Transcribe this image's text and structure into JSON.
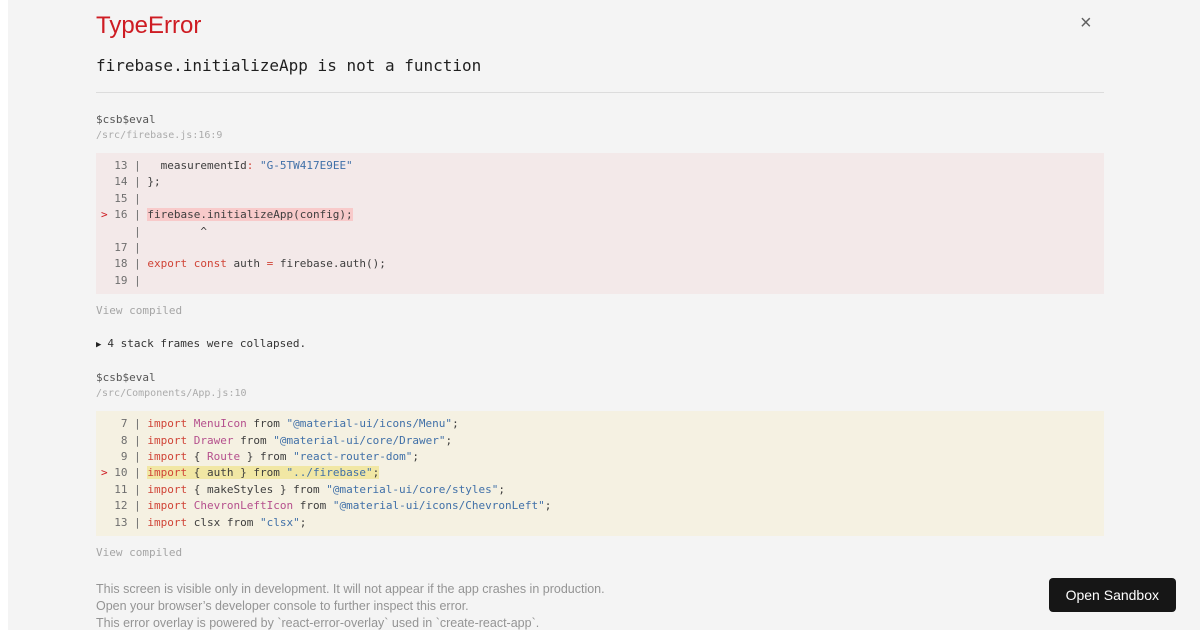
{
  "overlay": {
    "title": "TypeError",
    "message": "firebase.initializeApp is not a function",
    "close_glyph": "×"
  },
  "frames": [
    {
      "function": "$csb$eval",
      "location": "/src/firebase.js:16:9",
      "view_compiled": "View compiled",
      "variant": "error",
      "lines": [
        {
          "mark": " ",
          "num": "13",
          "tokens": [
            [
              "p",
              "  measurementId"
            ],
            [
              "k",
              ":"
            ],
            [
              "p",
              " "
            ],
            [
              "s",
              "\"G-5TW417E9EE\""
            ]
          ]
        },
        {
          "mark": " ",
          "num": "14",
          "tokens": [
            [
              "p",
              "};"
            ]
          ]
        },
        {
          "mark": " ",
          "num": "15",
          "tokens": []
        },
        {
          "mark": ">",
          "num": "16",
          "hl": true,
          "tokens": [
            [
              "p",
              "firebase.initializeApp(config);"
            ]
          ]
        },
        {
          "mark": " ",
          "num": "  ",
          "tokens": [
            [
              "p",
              "        ^"
            ]
          ]
        },
        {
          "mark": " ",
          "num": "17",
          "tokens": []
        },
        {
          "mark": " ",
          "num": "18",
          "tokens": [
            [
              "k",
              "export"
            ],
            [
              "p",
              " "
            ],
            [
              "k",
              "const"
            ],
            [
              "p",
              " auth "
            ],
            [
              "k",
              "="
            ],
            [
              "p",
              " firebase.auth();"
            ]
          ]
        },
        {
          "mark": " ",
          "num": "19",
          "tokens": []
        }
      ]
    },
    {
      "function": "$csb$eval",
      "location": "/src/Components/App.js:10",
      "view_compiled": "View compiled",
      "variant": "warning",
      "lines": [
        {
          "mark": " ",
          "num": " 7",
          "tokens": [
            [
              "k",
              "import"
            ],
            [
              "p",
              " "
            ],
            [
              "c",
              "MenuIcon"
            ],
            [
              "p",
              " from "
            ],
            [
              "s",
              "\"@material-ui/icons/Menu\""
            ],
            [
              "p",
              ";"
            ]
          ]
        },
        {
          "mark": " ",
          "num": " 8",
          "tokens": [
            [
              "k",
              "import"
            ],
            [
              "p",
              " "
            ],
            [
              "c",
              "Drawer"
            ],
            [
              "p",
              " from "
            ],
            [
              "s",
              "\"@material-ui/core/Drawer\""
            ],
            [
              "p",
              ";"
            ]
          ]
        },
        {
          "mark": " ",
          "num": " 9",
          "tokens": [
            [
              "k",
              "import"
            ],
            [
              "p",
              " { "
            ],
            [
              "c",
              "Route"
            ],
            [
              "p",
              " } from "
            ],
            [
              "s",
              "\"react-router-dom\""
            ],
            [
              "p",
              ";"
            ]
          ]
        },
        {
          "mark": ">",
          "num": "10",
          "hl": true,
          "tokens": [
            [
              "k",
              "import"
            ],
            [
              "p",
              " { auth } from "
            ],
            [
              "s",
              "\"../firebase\""
            ],
            [
              "p",
              ";"
            ]
          ]
        },
        {
          "mark": " ",
          "num": "11",
          "tokens": [
            [
              "k",
              "import"
            ],
            [
              "p",
              " { makeStyles } from "
            ],
            [
              "s",
              "\"@material-ui/core/styles\""
            ],
            [
              "p",
              ";"
            ]
          ]
        },
        {
          "mark": " ",
          "num": "12",
          "tokens": [
            [
              "k",
              "import"
            ],
            [
              "p",
              " "
            ],
            [
              "c",
              "ChevronLeftIcon"
            ],
            [
              "p",
              " from "
            ],
            [
              "s",
              "\"@material-ui/icons/ChevronLeft\""
            ],
            [
              "p",
              ";"
            ]
          ]
        },
        {
          "mark": " ",
          "num": "13",
          "tokens": [
            [
              "k",
              "import"
            ],
            [
              "p",
              " clsx from "
            ],
            [
              "s",
              "\"clsx\""
            ],
            [
              "p",
              ";"
            ]
          ]
        }
      ]
    }
  ],
  "collapsed": {
    "icon": "▶",
    "label": "4 stack frames were collapsed."
  },
  "footer": {
    "line1": "This screen is visible only in development. It will not appear if the app crashes in production.",
    "line2": "Open your browser’s developer console to further inspect this error.",
    "line3": "This error overlay is powered by `react-error-overlay` used in `create-react-app`.",
    "open_sandbox": "Open Sandbox"
  },
  "colors": {
    "accent_red": "#ce1c23",
    "keyword": "#d04437",
    "class_name": "#b5508d",
    "string": "#4070a8",
    "error_block_bg": "#f3e9e9",
    "error_line_bg": "#f8caca",
    "warning_block_bg": "#f5f1e2",
    "warning_line_bg": "#f1e7a4",
    "button_bg": "#161616"
  }
}
